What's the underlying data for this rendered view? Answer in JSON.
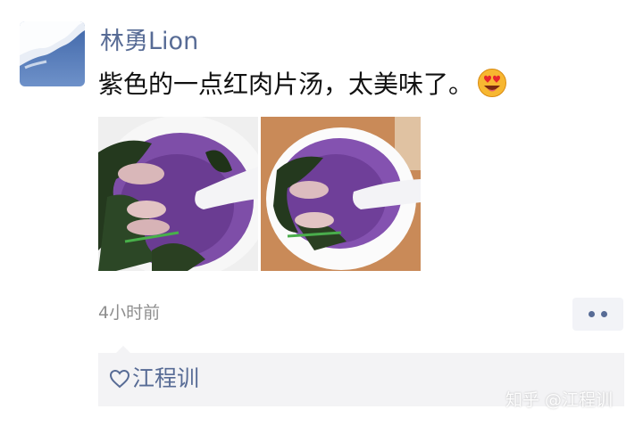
{
  "post": {
    "username": "林勇Lion",
    "text": "紫色的一点红肉片汤，太美味了。",
    "emoji": "heart-eyes-emoji",
    "timestamp": "4小时前"
  },
  "photos": [
    {
      "subject": "purple soup with greens, meat slices and spoon"
    },
    {
      "subject": "purple soup with greens, meat slices and spoon"
    }
  ],
  "likes": {
    "names": "江程训"
  },
  "watermark": "知乎 @江程训",
  "colors": {
    "link": "#576b95",
    "meta": "#8e8e8e",
    "panel": "#f3f3f5"
  }
}
